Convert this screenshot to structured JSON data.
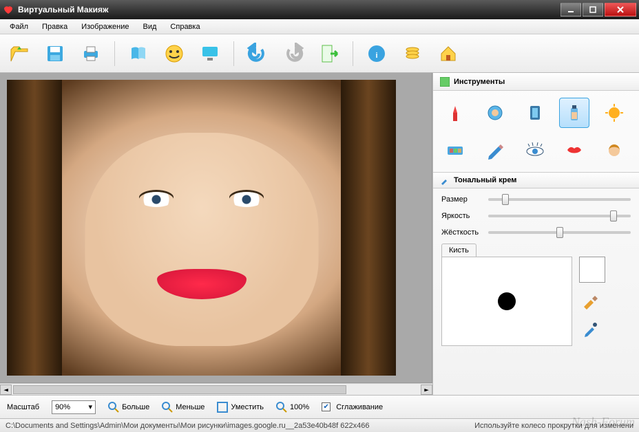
{
  "window": {
    "title": "Виртуальный Макияж"
  },
  "menu": {
    "file": "Файл",
    "edit": "Правка",
    "image": "Изображение",
    "view": "Вид",
    "help": "Справка"
  },
  "toolbar_icons": [
    "open",
    "save",
    "print",
    "book",
    "smiley",
    "monitor",
    "undo",
    "redo",
    "export",
    "info",
    "coins",
    "home"
  ],
  "sidebar": {
    "tools_header": "Инструменты",
    "tool_icons": [
      "lipstick",
      "compact",
      "mascara",
      "foundation",
      "sun",
      "eyeshadow",
      "pencil",
      "eye",
      "lips",
      "hair"
    ],
    "selected_tool": "foundation",
    "section_header": "Тональный крем",
    "sliders": {
      "size": {
        "label": "Размер",
        "value": 12
      },
      "bright": {
        "label": "Яркость",
        "value": 88
      },
      "hardness": {
        "label": "Жёсткость",
        "value": 50
      }
    },
    "brush_tab": "Кисть"
  },
  "bottom": {
    "zoom_label": "Масштаб",
    "zoom_value": "90%",
    "more": "Больше",
    "less": "Меньше",
    "fit": "Уместить",
    "full": "100%",
    "smooth": "Сглаживание",
    "smooth_checked": true
  },
  "status": {
    "left": "C:\\Documents and Settings\\Admin\\Мои документы\\Мои рисунки\\images.google.ru__2a53e40b48f 622x466",
    "right": "Используйте колесо прокрутки для изменени"
  },
  "watermark": "Nash-Forum"
}
